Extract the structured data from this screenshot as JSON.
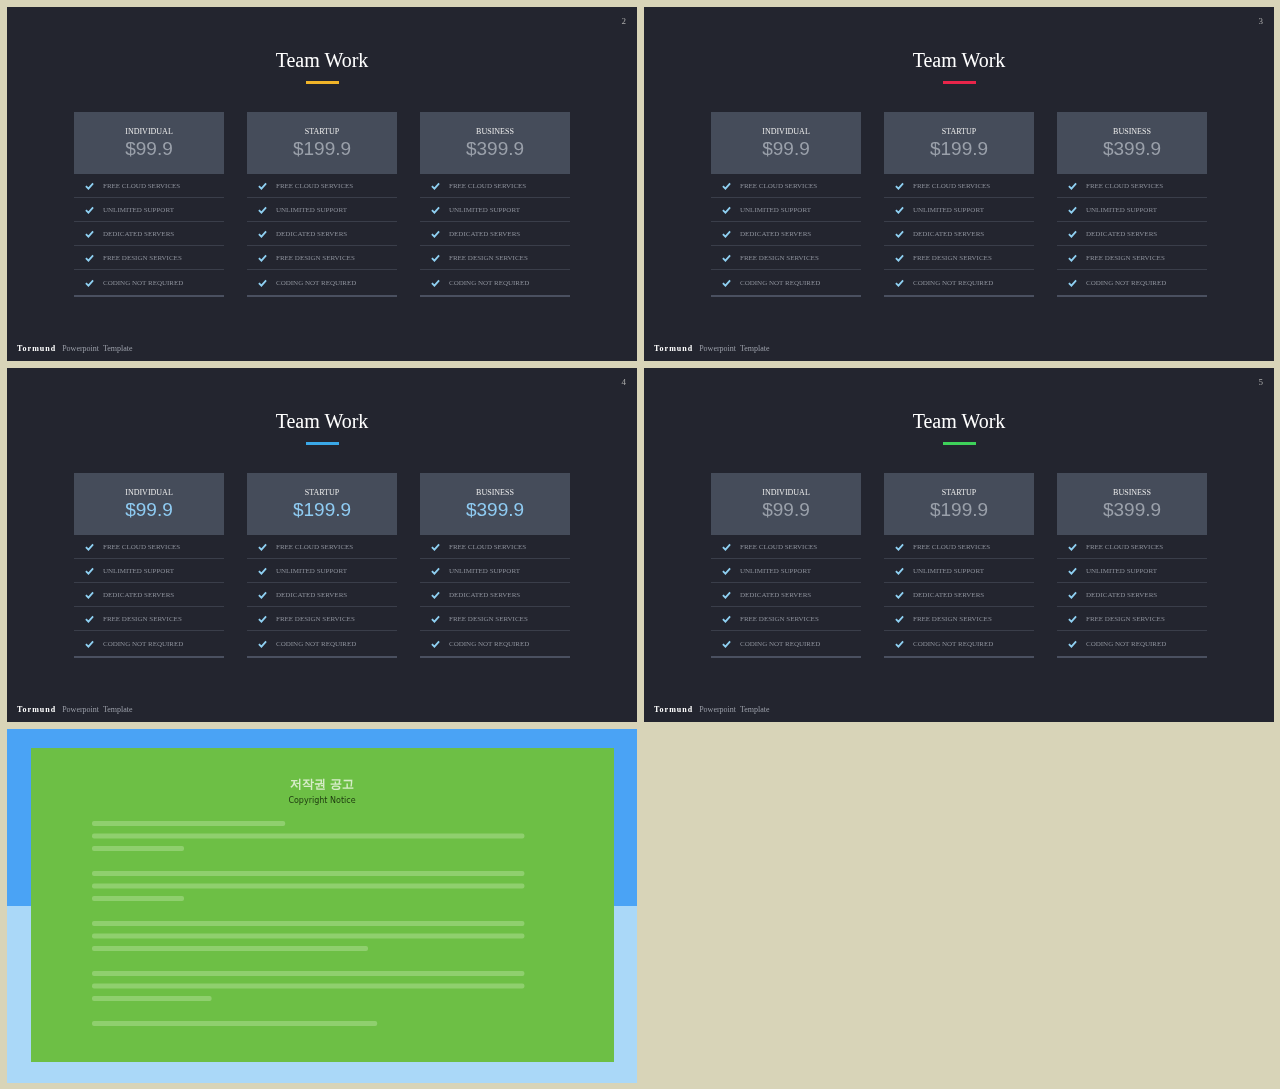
{
  "slides": [
    {
      "kind": "pricing",
      "number": "2",
      "title": "Team Work",
      "color": "#f0b429",
      "price_highlighted": false,
      "plans": [
        {
          "name": "INDIVIDUAL",
          "price": "$99.9",
          "features": [
            "FREE CLOUD SERVICES",
            "UNLIMITED SUPPORT",
            "DEDICATED SERVERS",
            "FREE DESIGN SERVICES",
            "CODING NOT REQUIRED"
          ]
        },
        {
          "name": "STARTUP",
          "price": "$199.9",
          "features": [
            "FREE CLOUD SERVICES",
            "UNLIMITED SUPPORT",
            "DEDICATED SERVERS",
            "FREE DESIGN SERVICES",
            "CODING NOT REQUIRED"
          ]
        },
        {
          "name": "BUSINESS",
          "price": "$399.9",
          "features": [
            "FREE CLOUD SERVICES",
            "UNLIMITED SUPPORT",
            "DEDICATED SERVERS",
            "FREE DESIGN SERVICES",
            "CODING NOT REQUIRED"
          ]
        }
      ],
      "footer": {
        "brand": "Tormund",
        "text": "Powerpoint  Template"
      }
    },
    {
      "kind": "pricing",
      "number": "3",
      "title": "Team Work",
      "color": "#e8254a",
      "price_highlighted": false,
      "plans": [
        {
          "name": "INDIVIDUAL",
          "price": "$99.9",
          "features": [
            "FREE CLOUD SERVICES",
            "UNLIMITED SUPPORT",
            "DEDICATED SERVERS",
            "FREE DESIGN SERVICES",
            "CODING NOT REQUIRED"
          ]
        },
        {
          "name": "STARTUP",
          "price": "$199.9",
          "features": [
            "FREE CLOUD SERVICES",
            "UNLIMITED SUPPORT",
            "DEDICATED SERVERS",
            "FREE DESIGN SERVICES",
            "CODING NOT REQUIRED"
          ]
        },
        {
          "name": "BUSINESS",
          "price": "$399.9",
          "features": [
            "FREE CLOUD SERVICES",
            "UNLIMITED SUPPORT",
            "DEDICATED SERVERS",
            "FREE DESIGN SERVICES",
            "CODING NOT REQUIRED"
          ]
        }
      ],
      "footer": {
        "brand": "Tormund",
        "text": "Powerpoint  Template"
      }
    },
    {
      "kind": "pricing",
      "number": "4",
      "title": "Team Work",
      "color": "#3aa8e8",
      "price_highlighted": true,
      "plans": [
        {
          "name": "INDIVIDUAL",
          "price": "$99.9",
          "features": [
            "FREE CLOUD SERVICES",
            "UNLIMITED SUPPORT",
            "DEDICATED SERVERS",
            "FREE DESIGN SERVICES",
            "CODING NOT REQUIRED"
          ]
        },
        {
          "name": "STARTUP",
          "price": "$199.9",
          "features": [
            "FREE CLOUD SERVICES",
            "UNLIMITED SUPPORT",
            "DEDICATED SERVERS",
            "FREE DESIGN SERVICES",
            "CODING NOT REQUIRED"
          ]
        },
        {
          "name": "BUSINESS",
          "price": "$399.9",
          "features": [
            "FREE CLOUD SERVICES",
            "UNLIMITED SUPPORT",
            "DEDICATED SERVERS",
            "FREE DESIGN SERVICES",
            "CODING NOT REQUIRED"
          ]
        }
      ],
      "footer": {
        "brand": "Tormund",
        "text": "Powerpoint  Template"
      }
    },
    {
      "kind": "pricing",
      "number": "5",
      "title": "Team Work",
      "color": "#3ed25a",
      "price_highlighted": false,
      "plans": [
        {
          "name": "INDIVIDUAL",
          "price": "$99.9",
          "features": [
            "FREE CLOUD SERVICES",
            "UNLIMITED SUPPORT",
            "DEDICATED SERVERS",
            "FREE DESIGN SERVICES",
            "CODING NOT REQUIRED"
          ]
        },
        {
          "name": "STARTUP",
          "price": "$199.9",
          "features": [
            "FREE CLOUD SERVICES",
            "UNLIMITED SUPPORT",
            "DEDICATED SERVERS",
            "FREE DESIGN SERVICES",
            "CODING NOT REQUIRED"
          ]
        },
        {
          "name": "BUSINESS",
          "price": "$399.9",
          "features": [
            "FREE CLOUD SERVICES",
            "UNLIMITED SUPPORT",
            "DEDICATED SERVERS",
            "FREE DESIGN SERVICES",
            "CODING NOT REQUIRED"
          ]
        }
      ],
      "footer": {
        "brand": "Tormund",
        "text": "Powerpoint  Template"
      }
    },
    {
      "kind": "notice",
      "title": "저작권 공고",
      "subtitle": "Copyright Notice"
    }
  ]
}
